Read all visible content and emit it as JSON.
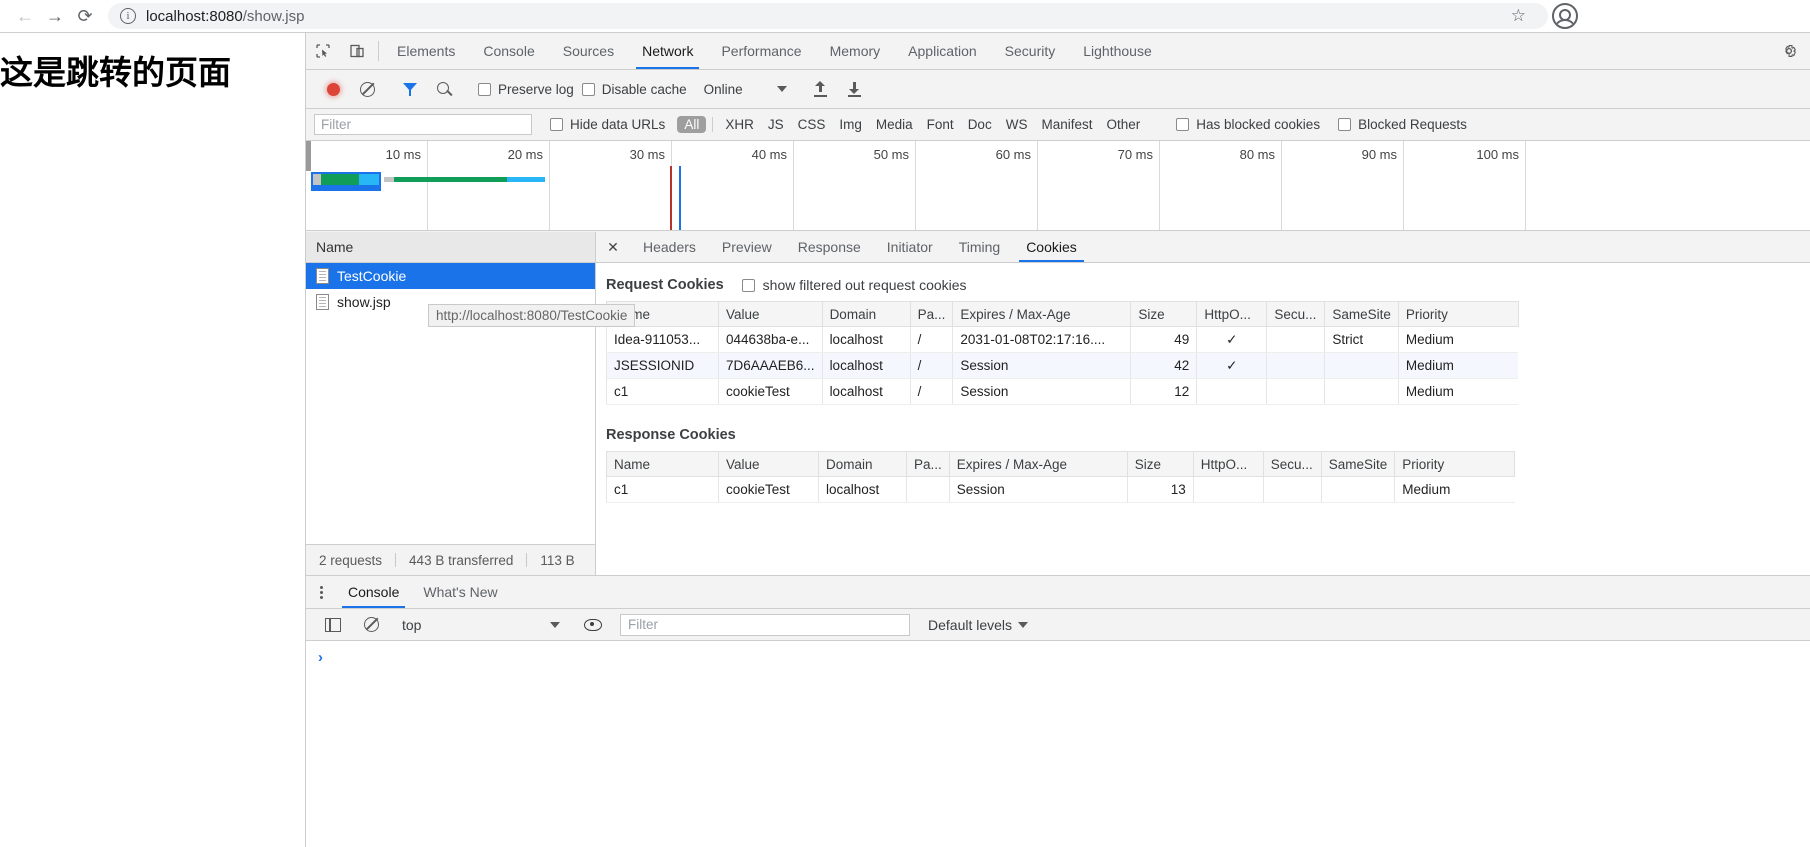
{
  "browser": {
    "back_icon": "back-arrow-icon",
    "forward_icon": "forward-arrow-icon",
    "reload_icon": "reload-icon",
    "info_icon": "ⓘ",
    "url_host": "localhost:8080",
    "url_path": "/show.jsp",
    "star_icon": "☆"
  },
  "page": {
    "heading": "这是跳转的页面"
  },
  "devtools": {
    "tabs": [
      {
        "label": "Elements",
        "active": false
      },
      {
        "label": "Console",
        "active": false
      },
      {
        "label": "Sources",
        "active": false
      },
      {
        "label": "Network",
        "active": true
      },
      {
        "label": "Performance",
        "active": false
      },
      {
        "label": "Memory",
        "active": false
      },
      {
        "label": "Application",
        "active": false
      },
      {
        "label": "Security",
        "active": false
      },
      {
        "label": "Lighthouse",
        "active": false
      }
    ],
    "toolbar": {
      "record_label": "record-button",
      "clear_label": "clear-button",
      "filter_label": "filter-toggle",
      "search_label": "search-button",
      "preserve_log": "Preserve log",
      "disable_cache": "Disable cache",
      "throttling": "Online",
      "import_label": "import-har",
      "export_label": "export-har"
    },
    "filterbar": {
      "filter_placeholder": "Filter",
      "hide_data_urls": "Hide data URLs",
      "types": [
        "All",
        "XHR",
        "JS",
        "CSS",
        "Img",
        "Media",
        "Font",
        "Doc",
        "WS",
        "Manifest",
        "Other"
      ],
      "active_type": "All",
      "has_blocked_cookies": "Has blocked cookies",
      "blocked_requests": "Blocked Requests"
    },
    "overview": {
      "ticks": [
        "10 ms",
        "20 ms",
        "30 ms",
        "40 ms",
        "50 ms",
        "60 ms",
        "70 ms",
        "80 ms",
        "90 ms",
        "100 ms"
      ]
    },
    "requests": {
      "column_header": "Name",
      "rows": [
        {
          "name": "TestCookie",
          "selected": true
        },
        {
          "name": "show.jsp",
          "selected": false
        }
      ],
      "tooltip": "http://localhost:8080/TestCookie",
      "status": {
        "requests": "2 requests",
        "transferred": "443 B transferred",
        "resources": "113 B"
      }
    },
    "detail": {
      "close_icon": "✕",
      "tabs": [
        {
          "label": "Headers",
          "active": false
        },
        {
          "label": "Preview",
          "active": false
        },
        {
          "label": "Response",
          "active": false
        },
        {
          "label": "Initiator",
          "active": false
        },
        {
          "label": "Timing",
          "active": false
        },
        {
          "label": "Cookies",
          "active": true
        }
      ],
      "request_cookies": {
        "title": "Request Cookies",
        "show_filtered_label": "show filtered out request cookies",
        "columns": [
          "Name",
          "Value",
          "Domain",
          "Pa...",
          "Expires / Max-Age",
          "Size",
          "HttpO...",
          "Secu...",
          "SameSite",
          "Priority"
        ],
        "rows": [
          {
            "name": "Idea-911053...",
            "value": "044638ba-e...",
            "domain": "localhost",
            "path": "/",
            "expires": "2031-01-08T02:17:16....",
            "size": "49",
            "httponly": "✓",
            "secure": "",
            "samesite": "Strict",
            "priority": "Medium"
          },
          {
            "name": "JSESSIONID",
            "value": "7D6AAAEB6...",
            "domain": "localhost",
            "path": "/",
            "expires": "Session",
            "size": "42",
            "httponly": "✓",
            "secure": "",
            "samesite": "",
            "priority": "Medium"
          },
          {
            "name": "c1",
            "value": "cookieTest",
            "domain": "localhost",
            "path": "/",
            "expires": "Session",
            "size": "12",
            "httponly": "",
            "secure": "",
            "samesite": "",
            "priority": "Medium"
          }
        ]
      },
      "response_cookies": {
        "title": "Response Cookies",
        "columns": [
          "Name",
          "Value",
          "Domain",
          "Pa...",
          "Expires / Max-Age",
          "Size",
          "HttpO...",
          "Secu...",
          "SameSite",
          "Priority"
        ],
        "rows": [
          {
            "name": "c1",
            "value": "cookieTest",
            "domain": "localhost",
            "path": "",
            "expires": "Session",
            "size": "13",
            "httponly": "",
            "secure": "",
            "samesite": "",
            "priority": "Medium"
          }
        ]
      }
    },
    "drawer": {
      "tabs": [
        {
          "label": "Console",
          "active": true
        },
        {
          "label": "What's New",
          "active": false
        }
      ],
      "context": "top",
      "filter_placeholder": "Filter",
      "levels": "Default levels",
      "prompt": "›"
    }
  },
  "colors": {
    "accent": "#1a73e8",
    "selection": "#1a73e8",
    "record": "#db4437",
    "toolbar_bg": "#f3f3f3",
    "panel_bg": "#ffffff"
  }
}
